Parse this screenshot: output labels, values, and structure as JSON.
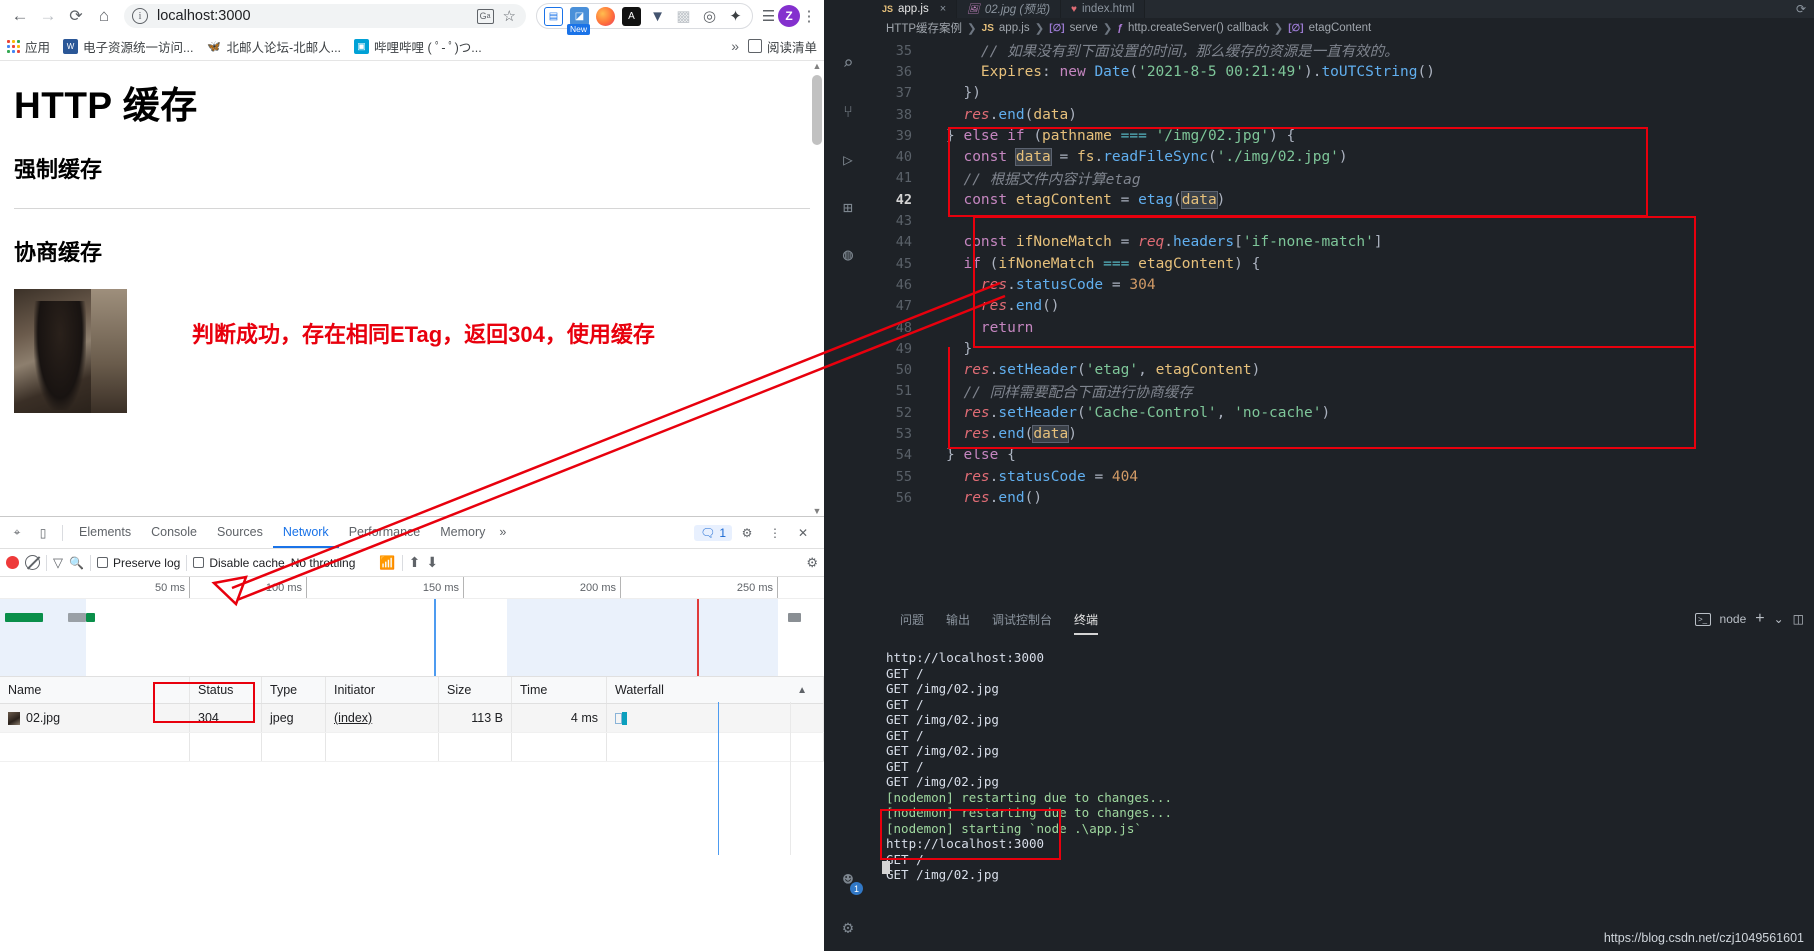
{
  "browser": {
    "nav": {
      "back": "←",
      "forward": "→",
      "reload": "C",
      "home": "⌂"
    },
    "omnibox": {
      "value": "localhost:3000",
      "info_icon": "info-icon",
      "translate_icon": "translate-icon",
      "star_icon": "star-icon"
    },
    "extensions": [
      {
        "name": "reading-list-ext",
        "glyph": "▤",
        "color": "#1a73e8",
        "badge": ""
      },
      {
        "name": "new-tab-ext",
        "glyph": "◪",
        "color": "#4a90d9",
        "badge": "New"
      },
      {
        "name": "firefox-ext",
        "glyph": "◯",
        "color": "#ff7139",
        "badge": ""
      },
      {
        "name": "altair-ext",
        "glyph": "A",
        "color": "#111111",
        "badge": ""
      },
      {
        "name": "vimium-ext",
        "glyph": "V",
        "color": "#44546f",
        "badge": ""
      },
      {
        "name": "qr-ext",
        "glyph": "▩",
        "color": "#9aa0a6",
        "badge": ""
      },
      {
        "name": "tracker-ext",
        "glyph": "◎",
        "color": "#5f6368",
        "badge": ""
      },
      {
        "name": "puzzle-ext",
        "glyph": "🧩",
        "color": "#5f6368",
        "badge": ""
      }
    ],
    "profile": {
      "initial": "Z",
      "color": "#8430ce"
    },
    "menu_glyph": "⋮",
    "bookmarks": {
      "apps_label": "应用",
      "items": [
        {
          "label": "电子资源统一访问...",
          "fav_color": "#2b5797",
          "fav_glyph": "W"
        },
        {
          "label": "北邮人论坛-北邮人...",
          "fav_color": "#ffffff",
          "fav_glyph": "🦋"
        },
        {
          "label": "哔哩哔哩 ( ﾟ- ﾟ)つ...",
          "fav_color": "#00a1d6",
          "fav_glyph": "🤖"
        }
      ],
      "overflow": "»",
      "reading_list": "阅读清单"
    },
    "page": {
      "h1": "HTTP 缓存",
      "h2_a": "强制缓存",
      "h2_b": "协商缓存",
      "annotation": "判断成功，存在相同ETag，返回304，使用缓存",
      "annotation_color": "#e8000d",
      "image_alt": "02.jpg"
    }
  },
  "devtools": {
    "inspect_icon": "inspect-icon",
    "device_icon": "device-toolbar-icon",
    "tabs": [
      {
        "label": "Elements",
        "active": false
      },
      {
        "label": "Console",
        "active": false
      },
      {
        "label": "Sources",
        "active": false
      },
      {
        "label": "Network",
        "active": true
      },
      {
        "label": "Performance",
        "active": false
      },
      {
        "label": "Memory",
        "active": false
      }
    ],
    "tabs_overflow": "»",
    "message_count": "1",
    "settings_icon": "gear-icon",
    "more_icon": "more-icon",
    "close_icon": "close-icon",
    "toolbar": {
      "record_icon": "record-icon",
      "clear_icon": "clear-icon",
      "filter_icon": "filter-icon",
      "search_icon": "search-icon",
      "preserve_log": "Preserve log",
      "preserve_log_checked": false,
      "disable_cache": "Disable cache",
      "disable_cache_checked": false,
      "throttling": "No throttling",
      "wifi_icon": "network-conditions-icon",
      "import_icon": "import-har-icon",
      "export_icon": "export-har-icon",
      "settings_icon": "network-settings-icon"
    },
    "overview": {
      "ticks": [
        "50 ms",
        "100 ms",
        "150 ms",
        "200 ms",
        "250 ms"
      ]
    },
    "table": {
      "columns": [
        "Name",
        "Status",
        "Type",
        "Initiator",
        "Size",
        "Time",
        "Waterfall"
      ],
      "rows": [
        {
          "name": "02.jpg",
          "status": "304",
          "type": "jpeg",
          "initiator": "(index)",
          "size": "113 B",
          "time": "4 ms"
        }
      ],
      "highlight_column": "Status",
      "highlight_color": "#e8000d"
    }
  },
  "vscode": {
    "tabs": [
      {
        "label": "app.js",
        "icon": "js-icon",
        "active": true,
        "italic": false,
        "close": "×"
      },
      {
        "label": "02.jpg (预览)",
        "icon": "image-icon",
        "active": false,
        "italic": true,
        "close": ""
      },
      {
        "label": "index.html",
        "icon": "html-icon",
        "active": false,
        "italic": false,
        "close": ""
      }
    ],
    "breadcrumb": [
      "HTTP缓存案例",
      "app.js",
      "serve",
      "http.createServer() callback",
      "etagContent"
    ],
    "activity_icons": [
      "search-icon",
      "source-control-icon",
      "run-debug-icon",
      "extensions-icon",
      "timeline-icon"
    ],
    "activity_bottom_icons": [
      "account-icon",
      "gear-icon"
    ],
    "account_badge": "1",
    "code": [
      {
        "num": "35",
        "current": false,
        "html": "    <span class='t-cmt'>// 如果没有到下面设置的时间，那么缓存的资源是一直有效的。</span>"
      },
      {
        "num": "36",
        "current": false,
        "html": "    <span class='t-var'>Expires</span><span class='t-pl'>: </span><span class='t-kw'>new</span> <span class='t-fn'>Date</span><span class='t-pl'>(</span><span class='t-str'>'2021-8-5 00:21:49'</span><span class='t-pl'>).</span><span class='t-fn'>toUTCString</span><span class='t-pl'>()</span>"
      },
      {
        "num": "37",
        "current": false,
        "html": "  <span class='t-pl'>})</span>"
      },
      {
        "num": "38",
        "current": false,
        "html": "  <span class='t-obj'>res</span><span class='t-pl'>.</span><span class='t-fn'>end</span><span class='t-pl'>(</span><span class='t-var'>data</span><span class='t-pl'>)</span>"
      },
      {
        "num": "39",
        "current": false,
        "html": "<span class='t-pl'>} </span><span class='t-kw'>else if</span> <span class='t-pl'>(</span><span class='t-var'>pathname</span> <span class='t-op'>===</span> <span class='t-str'>'/img/02.jpg'</span><span class='t-pl'>) {</span>"
      },
      {
        "num": "40",
        "current": false,
        "html": "  <span class='t-kw'>const</span> <span class='t-var sel'>data</span> <span class='t-pl'>= </span><span class='t-var'>fs</span><span class='t-pl'>.</span><span class='t-fn'>readFileSync</span><span class='t-pl'>(</span><span class='t-str'>'./img/02.jpg'</span><span class='t-pl'>)</span>"
      },
      {
        "num": "41",
        "current": false,
        "html": "  <span class='t-cmt'>// 根据文件内容计算etag</span>"
      },
      {
        "num": "42",
        "current": true,
        "html": "  <span class='t-kw'>const</span> <span class='t-var'>etagContent</span> <span class='t-pl'>= </span><span class='t-fn'>etag</span><span class='t-pl'>(</span><span class='t-var sel'>data</span><span class='t-pl'>)</span>"
      },
      {
        "num": "43",
        "current": false,
        "html": ""
      },
      {
        "num": "44",
        "current": false,
        "html": "  <span class='t-kw'>const</span> <span class='t-var'>ifNoneMatch</span> <span class='t-pl'>= </span><span class='t-obj'>req</span><span class='t-pl'>.</span><span class='t-prop'>headers</span><span class='t-pl'>[</span><span class='t-str'>'if-none-match'</span><span class='t-pl'>]</span>"
      },
      {
        "num": "45",
        "current": false,
        "html": "  <span class='t-kw'>if</span> <span class='t-pl'>(</span><span class='t-var'>ifNoneMatch</span> <span class='t-op'>===</span> <span class='t-var'>etagContent</span><span class='t-pl'>) {</span>"
      },
      {
        "num": "46",
        "current": false,
        "html": "    <span class='t-obj'>res</span><span class='t-pl'>.</span><span class='t-prop'>statusCode</span> <span class='t-pl'>= </span><span class='t-num'>304</span>"
      },
      {
        "num": "47",
        "current": false,
        "html": "    <span class='t-obj'>res</span><span class='t-pl'>.</span><span class='t-fn'>end</span><span class='t-pl'>()</span>"
      },
      {
        "num": "48",
        "current": false,
        "html": "    <span class='t-kw'>return</span>"
      },
      {
        "num": "49",
        "current": false,
        "html": "  <span class='t-pl'>}</span>"
      },
      {
        "num": "50",
        "current": false,
        "html": "  <span class='t-obj'>res</span><span class='t-pl'>.</span><span class='t-fn'>setHeader</span><span class='t-pl'>(</span><span class='t-str'>'etag'</span><span class='t-pl'>, </span><span class='t-var'>etagContent</span><span class='t-pl'>)</span>"
      },
      {
        "num": "51",
        "current": false,
        "html": "  <span class='t-cmt'>// 同样需要配合下面进行协商缓存</span>"
      },
      {
        "num": "52",
        "current": false,
        "html": "  <span class='t-obj'>res</span><span class='t-pl'>.</span><span class='t-fn'>setHeader</span><span class='t-pl'>(</span><span class='t-str'>'Cache-Control'</span><span class='t-pl'>, </span><span class='t-str'>'no-cache'</span><span class='t-pl'>)</span>"
      },
      {
        "num": "53",
        "current": false,
        "html": "  <span class='t-obj'>res</span><span class='t-pl'>.</span><span class='t-fn'>end</span><span class='t-pl'>(</span><span class='t-var sel'>data</span><span class='t-pl'>)</span>"
      },
      {
        "num": "54",
        "current": false,
        "html": "<span class='t-pl'>} </span><span class='t-kw'>else</span> <span class='t-pl'>{</span>"
      },
      {
        "num": "55",
        "current": false,
        "html": "  <span class='t-obj'>res</span><span class='t-pl'>.</span><span class='t-prop'>statusCode</span> <span class='t-pl'>= </span><span class='t-num'>404</span>"
      },
      {
        "num": "56",
        "current": false,
        "html": "  <span class='t-obj'>res</span><span class='t-pl'>.</span><span class='t-fn'>end</span><span class='t-pl'>()</span>"
      }
    ],
    "panel": {
      "tabs": [
        {
          "label": "问题",
          "active": false
        },
        {
          "label": "输出",
          "active": false
        },
        {
          "label": "调试控制台",
          "active": false
        },
        {
          "label": "终端",
          "active": true
        }
      ],
      "shell": "node",
      "add_icon": "+",
      "chevron_icon": "⌄",
      "split_icon": "split-terminal-icon",
      "terminal_lines": [
        {
          "text": "http://localhost:3000",
          "white": true
        },
        {
          "text": "GET /",
          "white": true
        },
        {
          "text": "GET /img/02.jpg",
          "white": true
        },
        {
          "text": "GET /",
          "white": true
        },
        {
          "text": "GET /img/02.jpg",
          "white": true
        },
        {
          "text": "GET /",
          "white": true
        },
        {
          "text": "GET /img/02.jpg",
          "white": true
        },
        {
          "text": "GET /",
          "white": true
        },
        {
          "text": "GET /img/02.jpg",
          "white": true
        },
        {
          "text": "[nodemon] restarting due to changes...",
          "white": false
        },
        {
          "text": "[nodemon] restarting due to changes...",
          "white": false
        },
        {
          "text": "[nodemon] starting `node .\\app.js`",
          "white": false
        },
        {
          "text": "http://localhost:3000",
          "white": true
        },
        {
          "text": "GET /",
          "white": true
        },
        {
          "text": "GET /img/02.jpg",
          "white": true
        }
      ]
    }
  },
  "watermark": "https://blog.csdn.net/czj1049561601"
}
